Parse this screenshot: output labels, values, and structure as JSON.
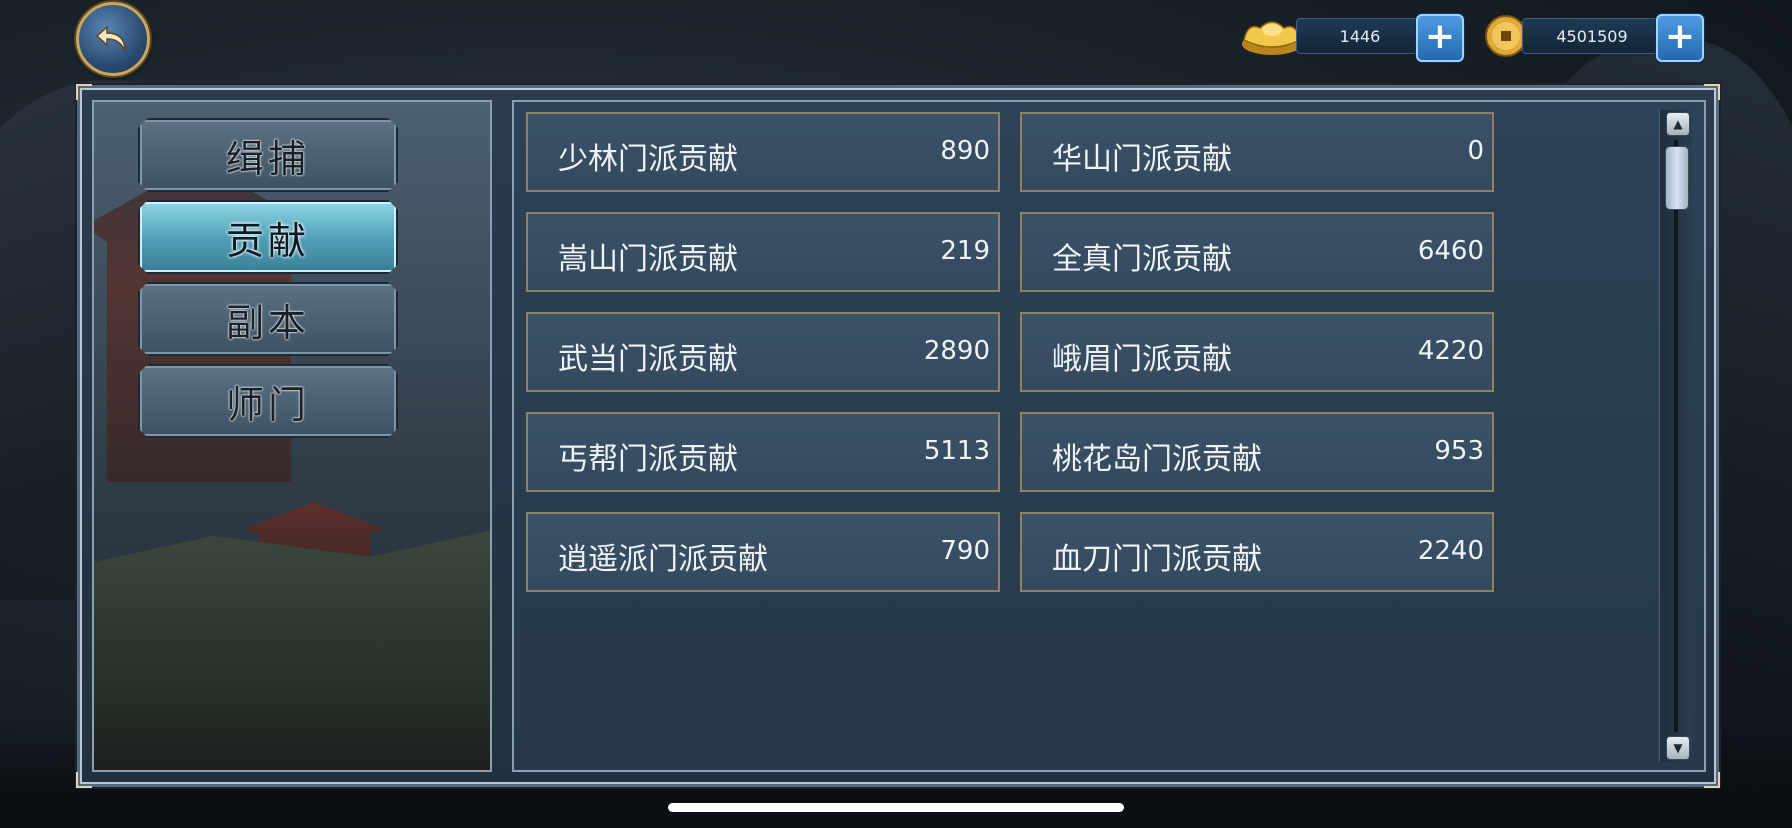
{
  "currency": {
    "gold_ingot": {
      "icon": "gold-ingot-icon",
      "amount": "1446"
    },
    "coin": {
      "icon": "copper-coin-icon",
      "amount": "4501509"
    }
  },
  "tabs": [
    {
      "label": "缉捕",
      "active": false
    },
    {
      "label": "贡献",
      "active": true
    },
    {
      "label": "副本",
      "active": false
    },
    {
      "label": "师门",
      "active": false
    }
  ],
  "contributions": [
    {
      "label": "少林门派贡献",
      "value": "890"
    },
    {
      "label": "华山门派贡献",
      "value": "0"
    },
    {
      "label": "嵩山门派贡献",
      "value": "219"
    },
    {
      "label": "全真门派贡献",
      "value": "6460"
    },
    {
      "label": "武当门派贡献",
      "value": "2890"
    },
    {
      "label": "峨眉门派贡献",
      "value": "4220"
    },
    {
      "label": "丐帮门派贡献",
      "value": "5113"
    },
    {
      "label": "桃花岛门派贡献",
      "value": "953"
    },
    {
      "label": "逍遥派门派贡献",
      "value": "790"
    },
    {
      "label": "血刀门门派贡献",
      "value": "2240"
    }
  ],
  "colors": {
    "cell_border": "#8d8360",
    "active_tab": "#6fd8f5",
    "plus_button": "#2f7fcc"
  }
}
